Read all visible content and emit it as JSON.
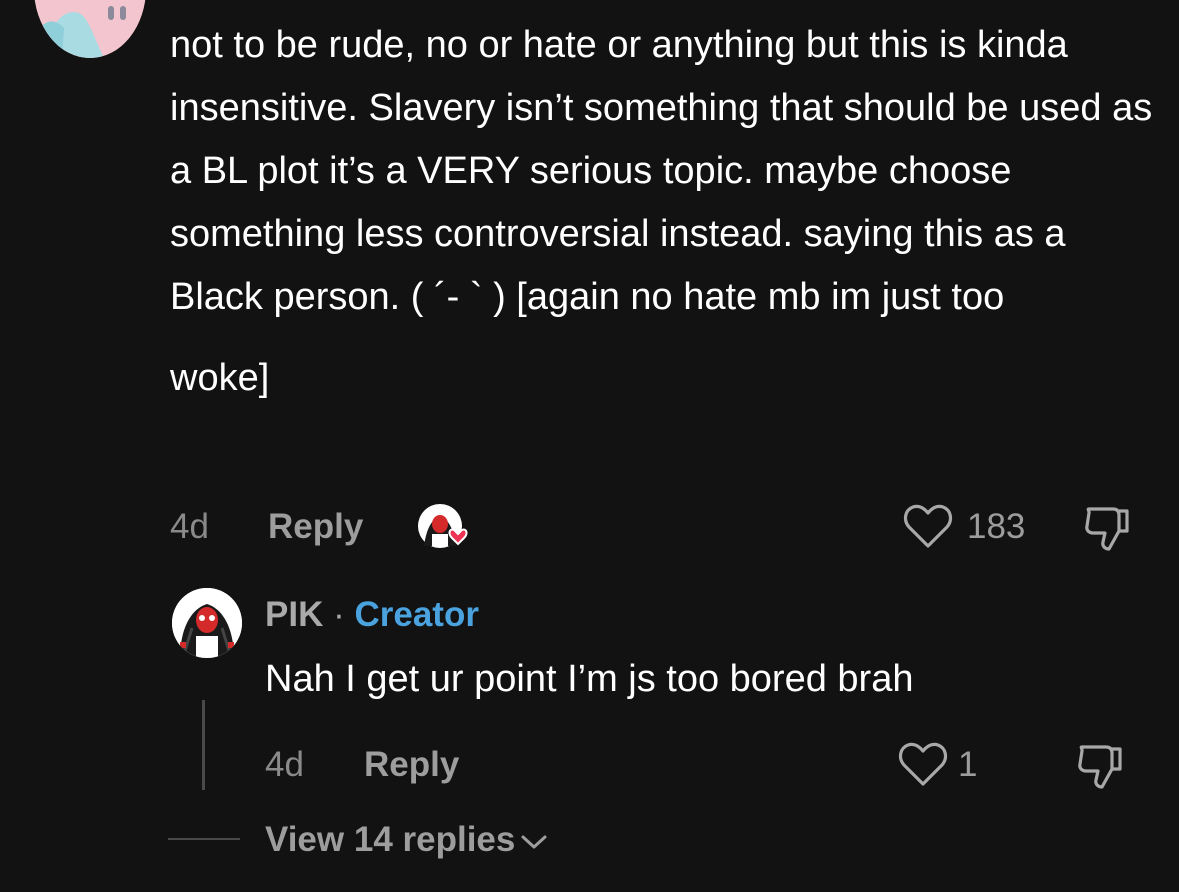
{
  "comment": {
    "text_main": "not to be rude, no or hate or anything but this is kinda insensitive. Slavery isn’t something that should be used as a BL plot it’s a VERY serious topic. maybe choose something less controversial instead. saying this as a Black person. ( ´- ` ) [again no hate mb im just too",
    "text_tail": "woke]",
    "age": "4d",
    "reply_label": "Reply",
    "like_count": "183",
    "creator_liked": true
  },
  "reply": {
    "author": "PIK",
    "separator": "·",
    "badge": "Creator",
    "text": "Nah I get ur point I’m js too bored brah",
    "age": "4d",
    "reply_label": "Reply",
    "like_count": "1"
  },
  "thread": {
    "view_replies_label": "View 14 replies"
  },
  "colors": {
    "background": "#121212",
    "creator_badge": "#4aa3df",
    "muted_text": "#9d9d9d",
    "heart": "#ee3355"
  }
}
